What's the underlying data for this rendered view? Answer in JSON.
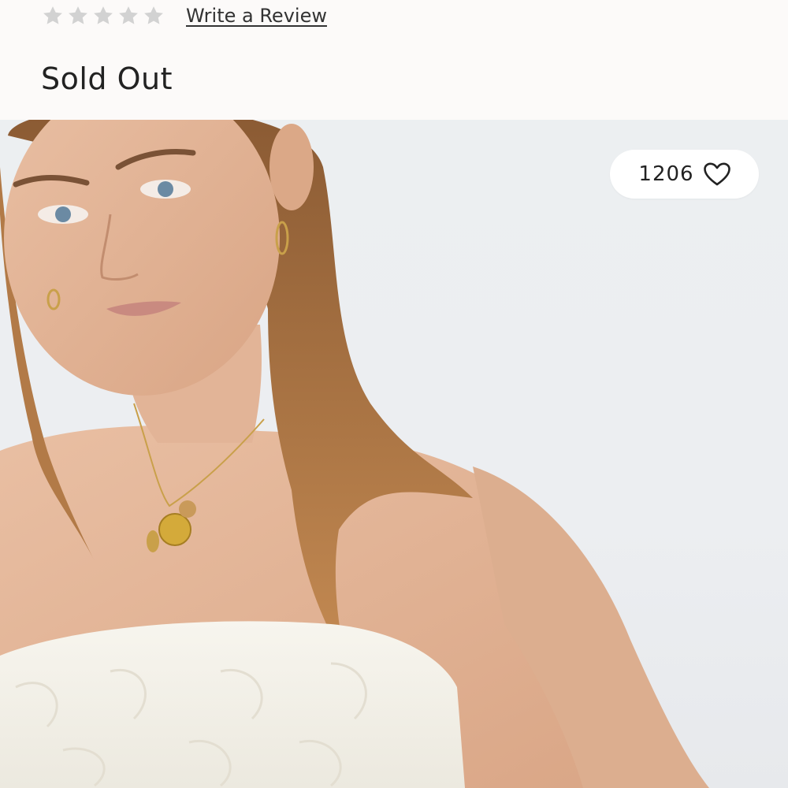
{
  "rating": {
    "stars_total": 5,
    "stars_filled": 0,
    "star_color": "#cfcfcf",
    "write_review_label": "Write a Review"
  },
  "product": {
    "availability": "Sold Out"
  },
  "favorites": {
    "count": "1206",
    "icon": "heart-outline-icon"
  },
  "image": {
    "description_kind": "product-photo"
  }
}
